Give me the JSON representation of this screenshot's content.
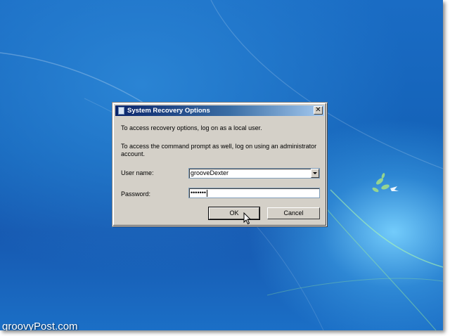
{
  "dialog": {
    "title": "System Recovery Options",
    "message_1": "To access recovery options, log on as a local user.",
    "message_2_line_1": "To access the command prompt as well, log on using an administrator",
    "message_2_line_2": "account.",
    "username_label": "User name:",
    "username_value": "grooveDexter",
    "password_label": "Password:",
    "password_value": "•••••••",
    "ok_label": "OK",
    "cancel_label": "Cancel"
  },
  "watermark": "groovyPost.com",
  "icons": {
    "title": "window-icon",
    "close": "close-icon",
    "dropdown": "chevron-down-icon",
    "pointer": "mouse-pointer-icon"
  },
  "colors": {
    "desktop_blue": "#1462b8",
    "dialog_face": "#d4d0c8",
    "title_gradient_start": "#0a246a",
    "title_gradient_end": "#a6caf0"
  }
}
